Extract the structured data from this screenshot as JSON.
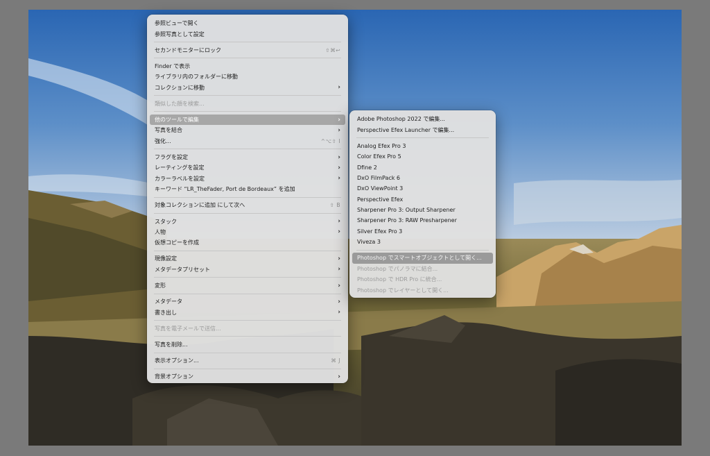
{
  "context_menu": {
    "items": [
      {
        "label": "参照ビューで開く",
        "shortcut": "",
        "submenu": false,
        "disabled": false,
        "highlighted": false
      },
      {
        "label": "参照写真として設定",
        "shortcut": "",
        "submenu": false,
        "disabled": false,
        "highlighted": false
      },
      {
        "separator": true
      },
      {
        "label": "セカンドモニターにロック",
        "shortcut": "⇧⌘↩",
        "submenu": false,
        "disabled": false,
        "highlighted": false
      },
      {
        "separator": true
      },
      {
        "label": "Finder で表示",
        "shortcut": "",
        "submenu": false,
        "disabled": false,
        "highlighted": false
      },
      {
        "label": "ライブラリ内のフォルダーに移動",
        "shortcut": "",
        "submenu": false,
        "disabled": false,
        "highlighted": false
      },
      {
        "label": "コレクションに移動",
        "shortcut": "",
        "submenu": true,
        "disabled": false,
        "highlighted": false
      },
      {
        "separator": true
      },
      {
        "label": "類似した顔を検索...",
        "shortcut": "",
        "submenu": false,
        "disabled": true,
        "highlighted": false
      },
      {
        "separator": true
      },
      {
        "label": "他のツールで編集",
        "shortcut": "",
        "submenu": true,
        "disabled": false,
        "highlighted": true
      },
      {
        "label": "写真を結合",
        "shortcut": "",
        "submenu": true,
        "disabled": false,
        "highlighted": false
      },
      {
        "label": "強化...",
        "shortcut": "^⌥⇧ I",
        "submenu": false,
        "disabled": false,
        "highlighted": false
      },
      {
        "separator": true
      },
      {
        "label": "フラグを設定",
        "shortcut": "",
        "submenu": true,
        "disabled": false,
        "highlighted": false
      },
      {
        "label": "レーティングを設定",
        "shortcut": "",
        "submenu": true,
        "disabled": false,
        "highlighted": false
      },
      {
        "label": "カラーラベルを設定",
        "shortcut": "",
        "submenu": true,
        "disabled": false,
        "highlighted": false
      },
      {
        "label": "キーワード “LR_TheFader, Port de Bordeaux” を追加",
        "shortcut": "",
        "submenu": false,
        "disabled": false,
        "highlighted": false
      },
      {
        "separator": true
      },
      {
        "label": "対象コレクションに追加 にして次へ",
        "shortcut": "⇧ B",
        "submenu": false,
        "disabled": false,
        "highlighted": false
      },
      {
        "separator": true
      },
      {
        "label": "スタック",
        "shortcut": "",
        "submenu": true,
        "disabled": false,
        "highlighted": false
      },
      {
        "label": "人物",
        "shortcut": "",
        "submenu": true,
        "disabled": false,
        "highlighted": false
      },
      {
        "label": "仮想コピーを作成",
        "shortcut": "",
        "submenu": false,
        "disabled": false,
        "highlighted": false
      },
      {
        "separator": true
      },
      {
        "label": "現像設定",
        "shortcut": "",
        "submenu": true,
        "disabled": false,
        "highlighted": false
      },
      {
        "label": "メタデータプリセット",
        "shortcut": "",
        "submenu": true,
        "disabled": false,
        "highlighted": false
      },
      {
        "separator": true
      },
      {
        "label": "変形",
        "shortcut": "",
        "submenu": true,
        "disabled": false,
        "highlighted": false
      },
      {
        "separator": true
      },
      {
        "label": "メタデータ",
        "shortcut": "",
        "submenu": true,
        "disabled": false,
        "highlighted": false
      },
      {
        "label": "書き出し",
        "shortcut": "",
        "submenu": true,
        "disabled": false,
        "highlighted": false
      },
      {
        "separator": true
      },
      {
        "label": "写真を電子メールで送信...",
        "shortcut": "",
        "submenu": false,
        "disabled": true,
        "highlighted": false
      },
      {
        "separator": true
      },
      {
        "label": "写真を削除...",
        "shortcut": "",
        "submenu": false,
        "disabled": false,
        "highlighted": false
      },
      {
        "separator": true
      },
      {
        "label": "表示オプション...",
        "shortcut": "⌘ J",
        "submenu": false,
        "disabled": false,
        "highlighted": false
      },
      {
        "separator": true
      },
      {
        "label": "背景オプション",
        "shortcut": "",
        "submenu": true,
        "disabled": false,
        "highlighted": false
      }
    ]
  },
  "submenu": {
    "items": [
      {
        "label": "Adobe Photoshop 2022 で編集...",
        "disabled": false,
        "highlighted": false
      },
      {
        "label": "Perspective Efex Launcher で編集...",
        "disabled": false,
        "highlighted": false
      },
      {
        "separator": true
      },
      {
        "label": "Analog Efex Pro 3",
        "disabled": false,
        "highlighted": false
      },
      {
        "label": "Color Efex Pro 5",
        "disabled": false,
        "highlighted": false
      },
      {
        "label": "Dfine 2",
        "disabled": false,
        "highlighted": false
      },
      {
        "label": "DxO FilmPack 6",
        "disabled": false,
        "highlighted": false
      },
      {
        "label": "DxO ViewPoint 3",
        "disabled": false,
        "highlighted": false
      },
      {
        "label": "Perspective Efex",
        "disabled": false,
        "highlighted": false
      },
      {
        "label": "Sharpener Pro 3: Output Sharpener",
        "disabled": false,
        "highlighted": false
      },
      {
        "label": "Sharpener Pro 3: RAW Presharpener",
        "disabled": false,
        "highlighted": false
      },
      {
        "label": "Silver Efex Pro 3",
        "disabled": false,
        "highlighted": false
      },
      {
        "label": "Viveza 3",
        "disabled": false,
        "highlighted": false
      },
      {
        "separator": true
      },
      {
        "label": "Photoshop でスマートオブジェクトとして開く...",
        "disabled": false,
        "highlighted": true
      },
      {
        "label": "Photoshop でパノラマに結合...",
        "disabled": true,
        "highlighted": false
      },
      {
        "label": "Photoshop で HDR Pro に統合...",
        "disabled": true,
        "highlighted": false
      },
      {
        "label": "Photoshop でレイヤーとして開く...",
        "disabled": true,
        "highlighted": false
      }
    ]
  },
  "icons": {
    "submenu_arrow": "chevron-right-icon"
  },
  "colors": {
    "menu_background": "#e0e0e0",
    "highlight": "#a7a7a7",
    "disabled_text": "#9b9b9b"
  }
}
